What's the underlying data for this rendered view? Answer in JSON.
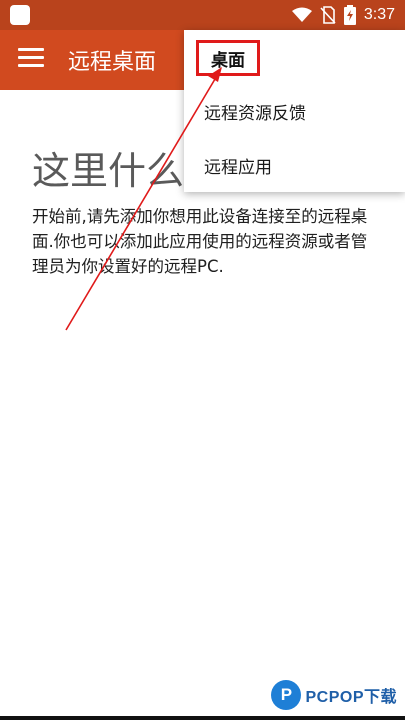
{
  "status_bar": {
    "time": "3:37",
    "icons": [
      "wifi-icon",
      "no-sim-icon",
      "battery-charging-icon"
    ]
  },
  "app_bar": {
    "title": "远程桌面"
  },
  "menu": {
    "items": [
      {
        "label": "桌面"
      },
      {
        "label": "远程资源反馈"
      },
      {
        "label": "远程应用"
      }
    ]
  },
  "empty_state": {
    "heading": "这里什么",
    "description": "开始前,请先添加你想用此设备连接至的远程桌面.你也可以添加此应用使用的远程资源或者管理员为你设置好的远程PC."
  },
  "watermark": {
    "logo_letter": "P",
    "text": "PCPOP下载"
  },
  "colors": {
    "app_bar": "#d14a1f",
    "status_bar": "#b9431c",
    "annotation": "#e01a1a"
  }
}
